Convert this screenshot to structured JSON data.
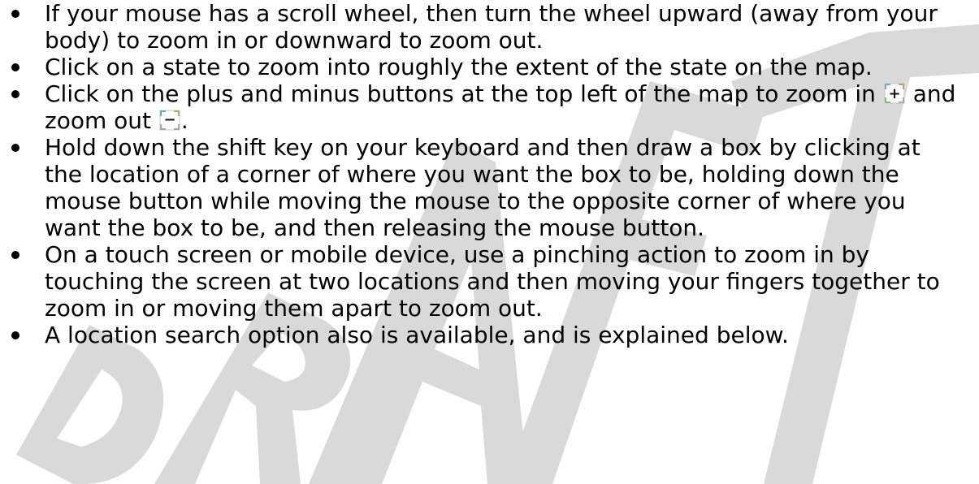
{
  "watermark": {
    "color": "#d9d9d9"
  },
  "bullets": [
    {
      "text": "If your mouse has a scroll wheel, then turn the wheel upward (away from your body) to zoom in or downward to zoom out."
    },
    {
      "text": "Click on a state to zoom into roughly the extent of the state on the map."
    },
    {
      "text_before": "Click on the plus and minus buttons at the top left of the map to zoom in",
      "plus_glyph": "+",
      "text_middle": "and zoom out",
      "minus_glyph": "−",
      "text_after": "."
    },
    {
      "text": "Hold down the shift key on your keyboard and then draw a box by clicking at the location of a corner of where you want the box to be, holding down the mouse button while moving the mouse to the opposite corner of where you want the box to be, and then releasing the mouse button."
    },
    {
      "text": "On a touch screen or mobile device, use a pinching action to zoom in by touching the screen at two locations and then moving your fingers together to zoom in or moving them apart to zoom out."
    },
    {
      "text": "A location search option also is available, and is explained below."
    }
  ]
}
